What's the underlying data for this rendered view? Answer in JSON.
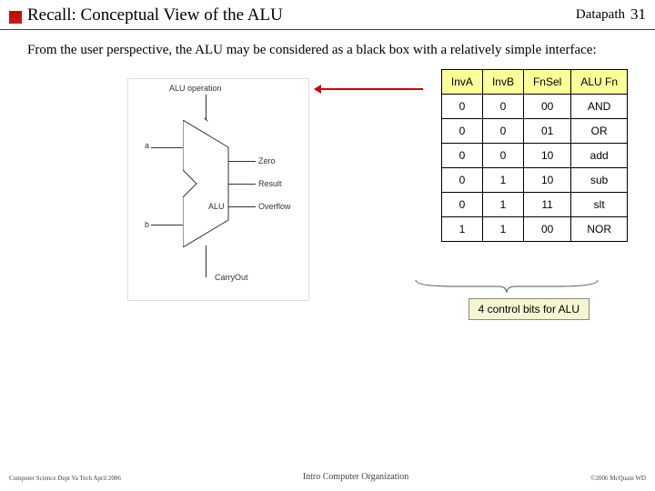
{
  "header": {
    "title": "Recall:  Conceptual View of the ALU",
    "section": "Datapath",
    "page": "31"
  },
  "intro": "From the user perspective, the ALU may be considered as a black box with a relatively simple interface:",
  "diagram": {
    "alu_op": "ALU operation",
    "a": "a",
    "b": "b",
    "alu": "ALU",
    "zero": "Zero",
    "result": "Result",
    "overflow": "Overflow",
    "carryout": "CarryOut"
  },
  "table": {
    "headers": [
      "InvA",
      "InvB",
      "FnSel",
      "ALU Fn"
    ],
    "rows": [
      [
        "0",
        "0",
        "00",
        "AND"
      ],
      [
        "0",
        "0",
        "01",
        "OR"
      ],
      [
        "0",
        "0",
        "10",
        "add"
      ],
      [
        "0",
        "1",
        "10",
        "sub"
      ],
      [
        "0",
        "1",
        "11",
        "slt"
      ],
      [
        "1",
        "1",
        "00",
        "NOR"
      ]
    ]
  },
  "caption": "4 control bits for ALU",
  "footer": {
    "left": "Computer Science Dept Va Tech April 2006",
    "center": "Intro Computer Organization",
    "right": "©2006  McQuain WD"
  }
}
